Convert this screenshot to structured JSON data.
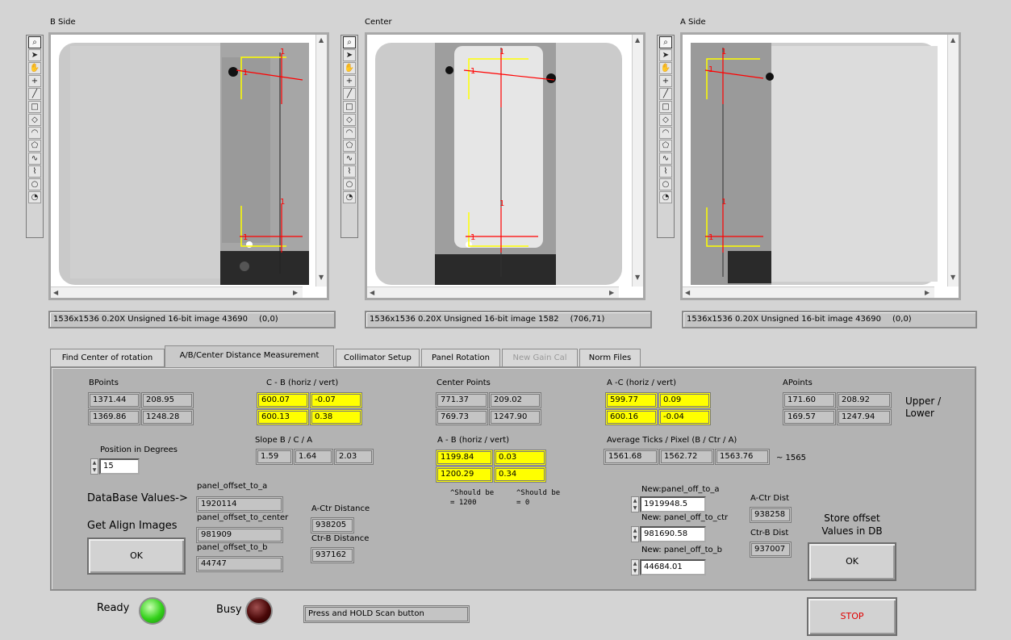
{
  "viewers": {
    "b_side": {
      "title": "B Side",
      "info": "1536x1536 0.20X Unsigned 16-bit image 43690",
      "coords": "(0,0)"
    },
    "center": {
      "title": "Center",
      "info": "1536x1536 0.20X Unsigned 16-bit image 1582",
      "coords": "(706,71)"
    },
    "a_side": {
      "title": "A Side",
      "info": "1536x1536 0.20X Unsigned 16-bit image 43690",
      "coords": "(0,0)"
    },
    "roi_marker": "1",
    "tools": [
      "zoom-icon",
      "pointer-icon",
      "pan-icon",
      "crosshair-icon",
      "line-icon",
      "rectangle-icon",
      "rotated-rectangle-icon",
      "annulus-icon",
      "polygon-icon",
      "freehand-icon",
      "broken-line-icon",
      "oval-icon",
      "annulus-arc-icon"
    ]
  },
  "tabs": [
    {
      "label": "Find Center of rotation",
      "active": false,
      "disabled": false
    },
    {
      "label": "A/B/Center Distance Measurement",
      "active": true,
      "disabled": false
    },
    {
      "label": "Collimator Setup",
      "active": false,
      "disabled": false
    },
    {
      "label": "Panel Rotation",
      "active": false,
      "disabled": false
    },
    {
      "label": "New Gain Cal",
      "active": false,
      "disabled": true
    },
    {
      "label": "Norm Files",
      "active": false,
      "disabled": false
    }
  ],
  "measurement": {
    "bpoints": {
      "label": "BPoints",
      "upper": [
        "1371.44",
        "208.95"
      ],
      "lower": [
        "1369.86",
        "1248.28"
      ]
    },
    "c_minus_b": {
      "label": "C - B (horiz / vert)",
      "upper": [
        "600.07",
        "-0.07"
      ],
      "lower": [
        "600.13",
        "0.38"
      ]
    },
    "center_points": {
      "label": "Center Points",
      "upper": [
        "771.37",
        "209.02"
      ],
      "lower": [
        "769.73",
        "1247.90"
      ]
    },
    "a_minus_c": {
      "label": "A -C (horiz / vert)",
      "upper": [
        "599.77",
        "0.09"
      ],
      "lower": [
        "600.16",
        "-0.04"
      ]
    },
    "apoints": {
      "label": "APoints",
      "upper": [
        "171.60",
        "208.92"
      ],
      "lower": [
        "169.57",
        "1247.94"
      ]
    },
    "upper_lower_label": "Upper /\nLower",
    "slope": {
      "label": "Slope B / C / A",
      "values": [
        "1.59",
        "1.64",
        "2.03"
      ]
    },
    "a_minus_b": {
      "label": "A - B (horiz / vert)",
      "upper": [
        "1199.84",
        "0.03"
      ],
      "lower": [
        "1200.29",
        "0.34"
      ]
    },
    "should_be_1200": "^Should be\n= 1200",
    "should_be_0": "^Should be\n= 0",
    "avg_ticks": {
      "label": "Average Ticks / Pixel (B / Ctr / A)",
      "values": [
        "1561.68",
        "1562.72",
        "1563.76"
      ],
      "approx": "~ 1565"
    },
    "position": {
      "label": "Position in Degrees",
      "value": "15"
    },
    "database_label": "DataBase Values->",
    "db_offsets": {
      "to_a_label": "panel_offset_to_a",
      "to_a": "1920114",
      "to_center_label": "panel_offset_to_center",
      "to_center": "981909",
      "to_b_label": "panel_offset_to_b",
      "to_b": "44747"
    },
    "db_distances": {
      "a_ctr_label": "A-Ctr Distance",
      "a_ctr": "938205",
      "ctr_b_label": "Ctr-B Distance",
      "ctr_b": "937162"
    },
    "get_align_label": "Get Align Images",
    "get_align_ok": "OK",
    "new_offsets": {
      "to_a_label": "New:panel_off_to_a",
      "to_a": "1919948.5",
      "to_ctr_label": "New: panel_off_to_ctr",
      "to_ctr": "981690.58",
      "to_b_label": "New: panel_off_to_b",
      "to_b": "44684.01"
    },
    "new_distances": {
      "a_ctr_label": "A-Ctr Dist",
      "a_ctr": "938258",
      "ctr_b_label": "Ctr-B Dist",
      "ctr_b": "937007"
    },
    "store_label": "Store offset\nValues in DB",
    "store_ok": "OK"
  },
  "status": {
    "ready_label": "Ready",
    "busy_label": "Busy",
    "message": "Press and HOLD Scan button",
    "stop_label": "STOP",
    "ready_color": "#33d11a",
    "busy_color": "#4a0808"
  }
}
